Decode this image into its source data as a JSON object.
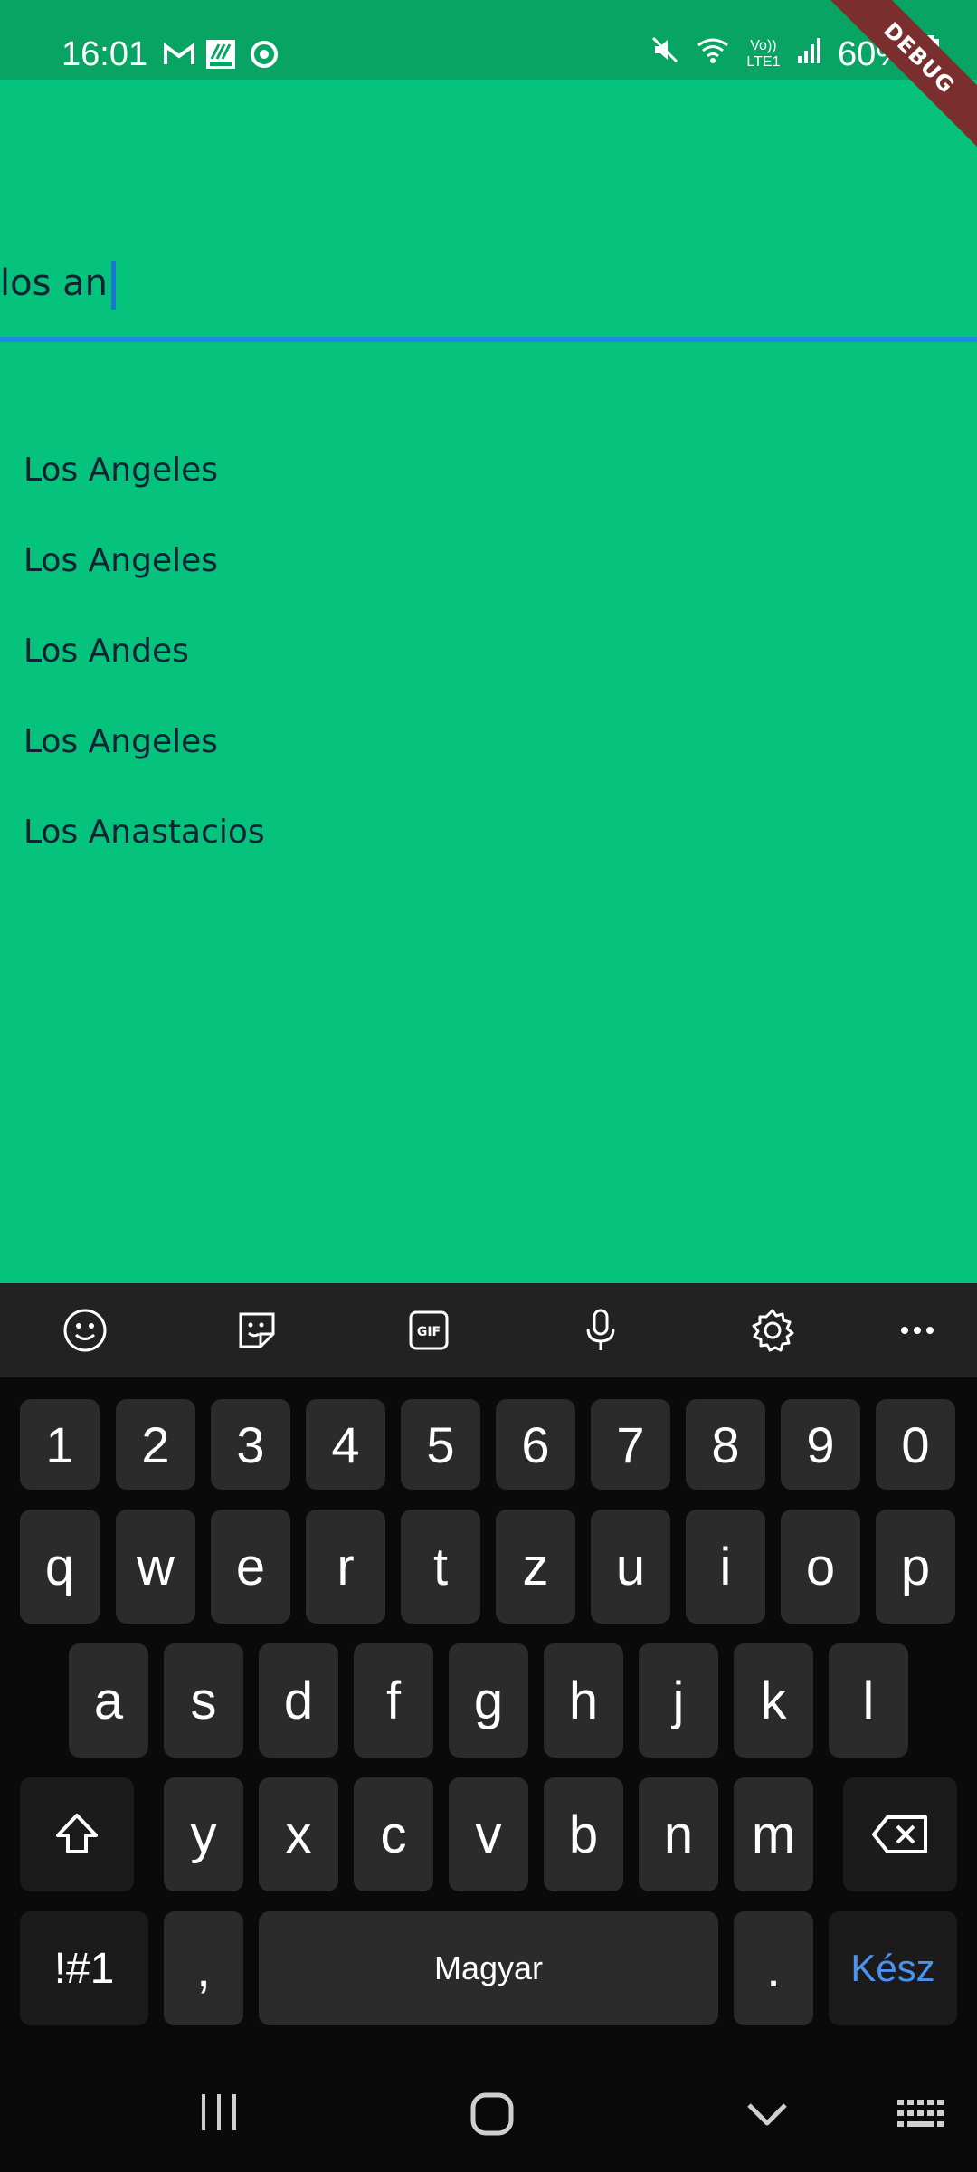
{
  "status_bar": {
    "time": "16:01",
    "battery": "60%",
    "left_icons": [
      "gmail-icon",
      "aldi-icon",
      "sync-icon"
    ],
    "right_icons": [
      "mute-icon",
      "wifi-icon",
      "volte-icon",
      "signal-icon",
      "battery-icon"
    ],
    "volte_text": "Vo)) LTE1"
  },
  "debug_banner": "DEBUG",
  "search": {
    "value": "los an"
  },
  "results": [
    "Los Angeles",
    "Los Angeles",
    "Los Andes",
    "Los Angeles",
    "Los Anastacios"
  ],
  "keyboard": {
    "toolbar_icons": [
      "emoji-icon",
      "sticker-icon",
      "gif-icon",
      "microphone-icon",
      "settings-icon",
      "more-icon"
    ],
    "row_numbers": [
      "1",
      "2",
      "3",
      "4",
      "5",
      "6",
      "7",
      "8",
      "9",
      "0"
    ],
    "row_q": [
      "q",
      "w",
      "e",
      "r",
      "t",
      "z",
      "u",
      "i",
      "o",
      "p"
    ],
    "row_a": [
      "a",
      "s",
      "d",
      "f",
      "g",
      "h",
      "j",
      "k",
      "l"
    ],
    "row_y": [
      "y",
      "x",
      "c",
      "v",
      "b",
      "n",
      "m"
    ],
    "symbols_label": "!#1",
    "comma": ",",
    "space_label": "Magyar",
    "period": ".",
    "done_label": "Kész",
    "done_color": "#4B93F2"
  },
  "nav": {
    "icons": [
      "recents-icon",
      "home-icon",
      "back-icon",
      "keyboard-icon"
    ]
  },
  "colors": {
    "background": "#05C27D",
    "status_bar": "#07A463",
    "accent": "#1E88E5",
    "debug": "#7B2E2E"
  }
}
